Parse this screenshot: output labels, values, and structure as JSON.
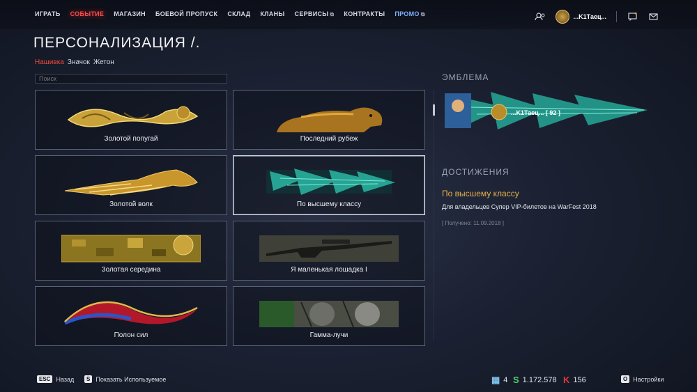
{
  "nav": {
    "items": [
      {
        "label": "ИГРАТЬ",
        "external": false
      },
      {
        "label": "СОБЫТИЕ",
        "external": false
      },
      {
        "label": "МАГАЗИН",
        "external": false
      },
      {
        "label": "БОЕВОЙ ПРОПУСК",
        "external": false
      },
      {
        "label": "СКЛАД",
        "external": false
      },
      {
        "label": "КЛАНЫ",
        "external": false
      },
      {
        "label": "СЕРВИСЫ",
        "external": true
      },
      {
        "label": "КОНТРАКТЫ",
        "external": false
      },
      {
        "label": "ПРОМО",
        "external": true
      }
    ],
    "external_glyph": "⧉",
    "username": "...K1Таец...",
    "icons": [
      "friends-icon",
      "messages-icon",
      "mail-icon"
    ]
  },
  "page": {
    "title": "ПЕРСОНАЛИЗАЦИЯ /.",
    "tabs": [
      "Нашивка",
      "Значок",
      "Жетон"
    ],
    "active_tab": "Нашивка",
    "search_placeholder": "Поиск"
  },
  "cards": [
    {
      "name": "Золотой попугай",
      "art": "gold"
    },
    {
      "name": "Последний рубеж",
      "art": "bear"
    },
    {
      "name": "Золотой волк",
      "art": "gold-wolf"
    },
    {
      "name": "По высшему классу",
      "art": "teal",
      "selected": true
    },
    {
      "name": "Золотая середина",
      "art": "camo"
    },
    {
      "name": "Я маленькая лошадка I",
      "art": "rifle"
    },
    {
      "name": "Полон сил",
      "art": "ribbon"
    },
    {
      "name": "Гамма-лучи",
      "art": "faces"
    }
  ],
  "right": {
    "emblem_title": "ЭМБЛЕМА",
    "emblem_nick": "...K1Таец... [ 92 ]",
    "achievements_title": "ДОСТИЖЕНИЯ",
    "achievement_name": "По высшему классу",
    "achievement_desc": "Для владельцев Супер VIP-билетов на WarFest 2018",
    "achievement_date": "[ Получено: 11.09.2018 ]"
  },
  "bottom": {
    "back_key": "ESC",
    "back_label": "Назад",
    "show_key": "S",
    "show_label": "Показать Используемое",
    "settings_key": "O",
    "settings_label": "Настройки",
    "currency_a": "4",
    "currency_s": "1.172.578",
    "currency_k": "156"
  },
  "colors": {
    "accent": "#f04a3a",
    "gold": "#e8b14a",
    "event": "#ff4a4a",
    "promo": "#6fa4ff"
  }
}
